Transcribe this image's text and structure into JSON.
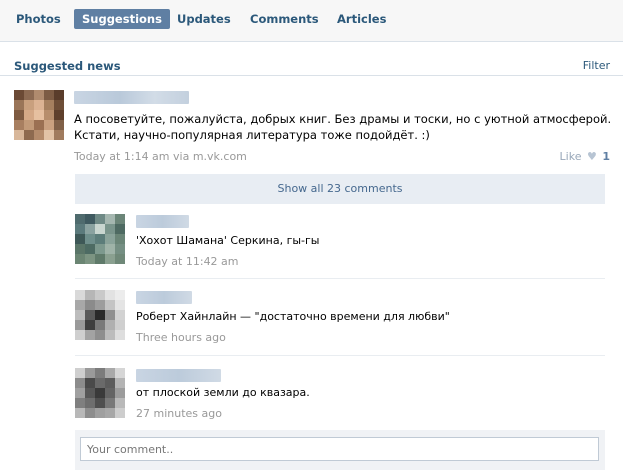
{
  "nav": {
    "tabs": [
      {
        "label": "Photos",
        "active": false
      },
      {
        "label": "Suggestions",
        "active": true
      },
      {
        "label": "Updates",
        "active": false
      },
      {
        "label": "Comments",
        "active": false
      },
      {
        "label": "Articles",
        "active": false
      }
    ]
  },
  "section": {
    "title": "Suggested news",
    "filter_label": "Filter"
  },
  "post": {
    "text": "А посоветуйте, пожалуйста, добрых книг. Без драмы и тоски, но с уютной атмосферой. Кстати, научно-популярная литература тоже подойдёт. :)",
    "meta": "Today at 1:14 am via m.vk.com",
    "like_label": "Like",
    "like_icon": "heart-icon",
    "like_count": "1"
  },
  "show_all_label": "Show all 23 comments",
  "replies": [
    {
      "text": "'Хохот Шамана' Серкина, гы-гы",
      "time": "Today at 11:42 am"
    },
    {
      "text": "Роберт Хайнлайн — \"достаточно времени для любви\"",
      "time": "Three hours ago"
    },
    {
      "text": "от плоской земли до квазара.",
      "time": "27 minutes ago"
    }
  ],
  "comment_field": {
    "placeholder": "Your comment.."
  },
  "colors": {
    "accent": "#2b587a",
    "active_tab": "#5f7fa3",
    "show_all_bg": "#e8edf3",
    "muted": "#999999"
  }
}
